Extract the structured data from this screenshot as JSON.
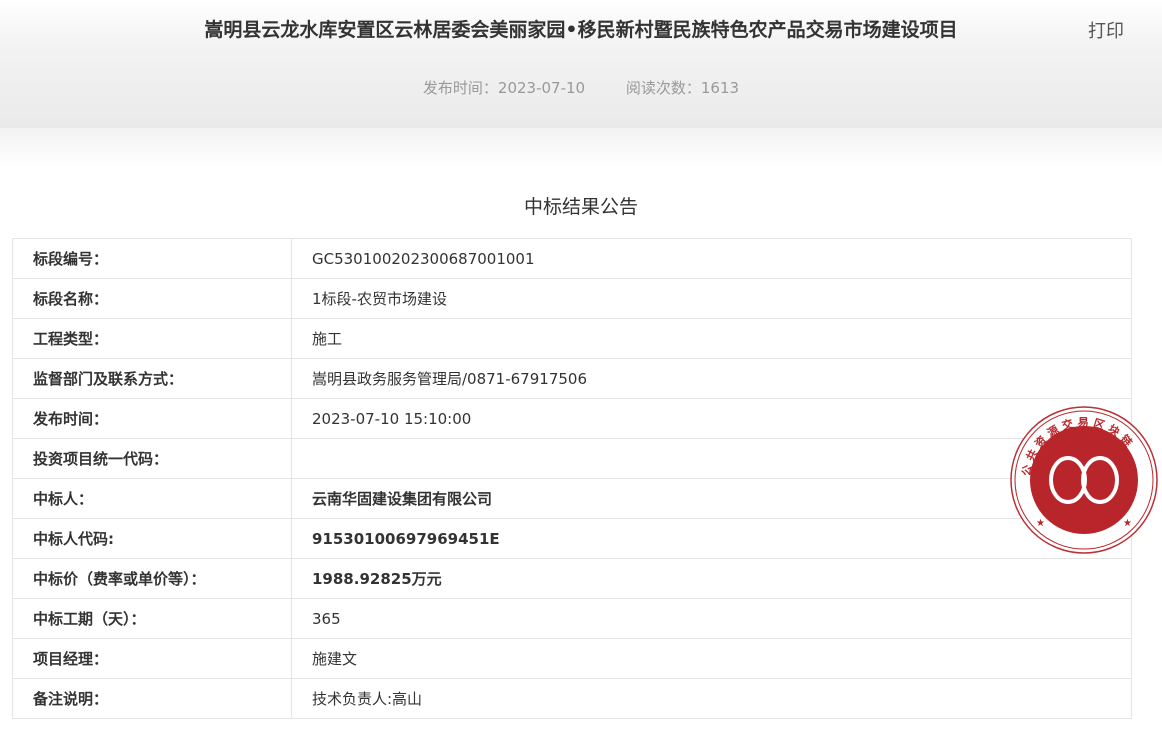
{
  "header": {
    "title": "嵩明县云龙水库安置区云林居委会美丽家园•移民新村暨民族特色农产品交易市场建设项目",
    "print_label": "打印",
    "publish_time": "发布时间：2023-07-10",
    "read_count": "阅读次数：1613"
  },
  "notice_title": "中标结果公告",
  "rows": [
    {
      "label": "标段编号：",
      "value": "GC5301002023006870​01001"
    },
    {
      "label": "标段名称：",
      "value": "1标段-农贸市场建设"
    },
    {
      "label": "工程类型：",
      "value": "施工"
    },
    {
      "label": "监督部门及联系方式：",
      "value": "嵩明县政务服务管理局/0871-67917506"
    },
    {
      "label": "发布时间：",
      "value": "2023-07-10 15:10:00"
    },
    {
      "label": "投资项目统一代码：",
      "value": ""
    },
    {
      "label": "中标人：",
      "value": "云南华固建设集团有限公司"
    },
    {
      "label": "中标人代码:",
      "value": "91530100697969451E"
    },
    {
      "label": "中标价（费率或单价等）：",
      "value": "1988.92825万元"
    },
    {
      "label": "中标工期（天）：",
      "value": "365"
    },
    {
      "label": "项目经理：",
      "value": "施建文"
    },
    {
      "label": "备注说明：",
      "value": "技术负责人:高山"
    }
  ],
  "seal": {
    "top_text": "公共资源交易区块链",
    "bottom_text": "存证标识",
    "color": "#b8252b"
  }
}
